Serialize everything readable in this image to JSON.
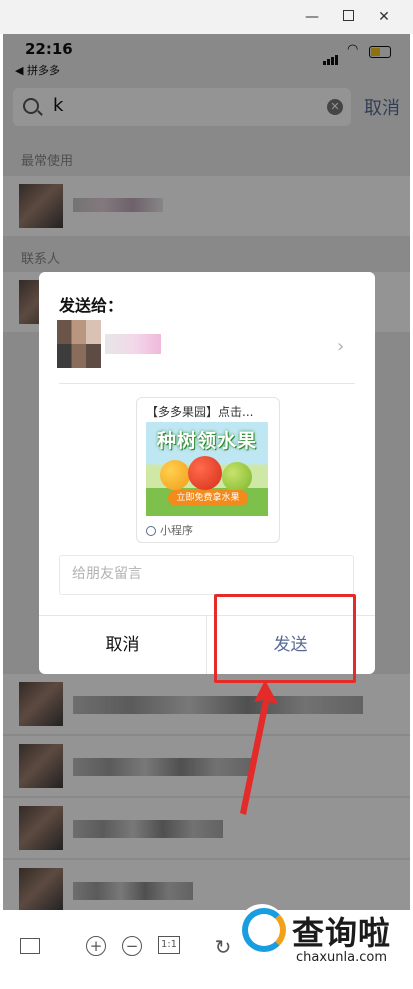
{
  "window": {
    "minimize": "—",
    "close": "✕"
  },
  "status_bar": {
    "time": "22:16",
    "back_app": "◀ 拼多多"
  },
  "search": {
    "query": "k",
    "cancel": "取消"
  },
  "sections": {
    "frequent": "最常使用",
    "contacts": "联系人"
  },
  "dialog": {
    "title": "发送给：",
    "chevron": "›",
    "mini_program": {
      "title": "【多多果园】点击...",
      "headline": "种树领水果",
      "cta": "立即免费拿水果",
      "footer": "小程序"
    },
    "message_placeholder": "给朋友留言",
    "cancel": "取消",
    "send": "发送"
  },
  "toolbar": {
    "zoom_in": "+",
    "zoom_out": "−",
    "actual_size": "1:1",
    "rotate": "↻"
  },
  "watermark": {
    "text": "查询啦",
    "url": "chaxunla.com"
  },
  "colors": {
    "link": "#576b95",
    "annotation": "#e52a2a",
    "overlay": "rgba(0,0,0,0.42)"
  }
}
